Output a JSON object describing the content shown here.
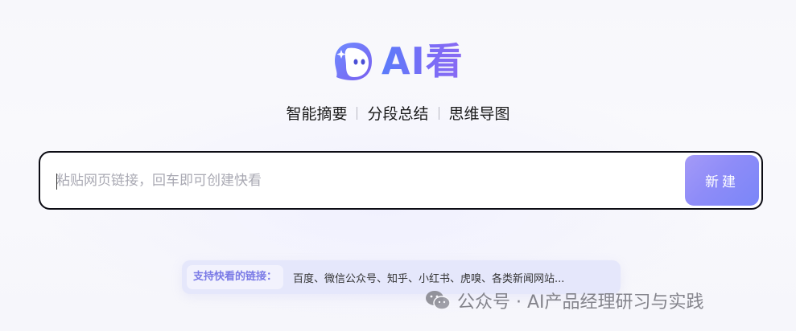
{
  "logo": {
    "text": "AI看",
    "icon": "ghost-face-logo-icon",
    "gradient": [
      "#5b7cfa",
      "#8a6af3"
    ]
  },
  "tagline": {
    "items": [
      "智能摘要",
      "分段总结",
      "思维导图"
    ]
  },
  "search": {
    "placeholder": "粘贴网页链接，回车即可创建快看",
    "value": "",
    "button_label": "新建",
    "button_gradient": [
      "#a49af7",
      "#7a86f8"
    ]
  },
  "supported": {
    "label": "支持快看的链接：",
    "sites": "百度、微信公众号、知乎、小红书、虎嗅、各类新闻网站..."
  },
  "watermark": {
    "icon": "wechat-icon",
    "text": "公众号 · AI产品经理研习与实践"
  }
}
